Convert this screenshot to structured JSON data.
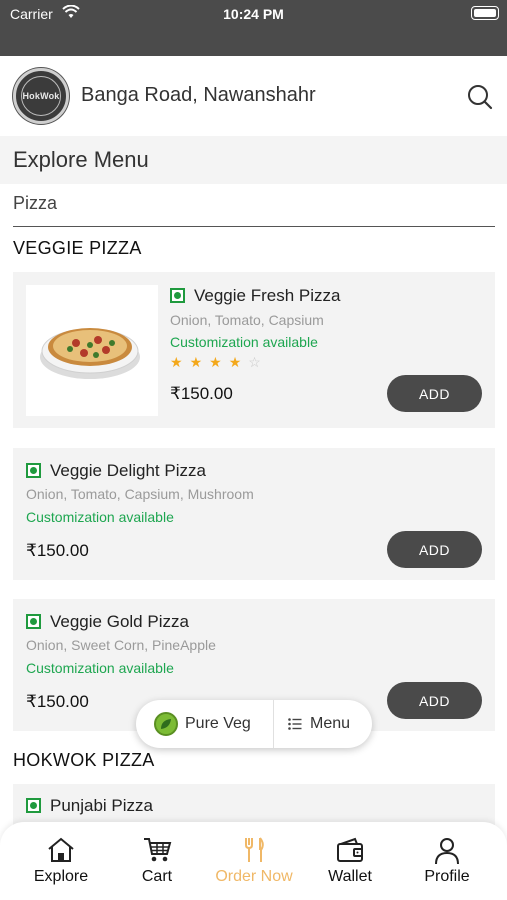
{
  "status_bar": {
    "carrier": "Carrier",
    "time": "10:24 PM"
  },
  "header": {
    "logo_text": "HokWok",
    "location": "Banga Road, Nawanshahr"
  },
  "explore": {
    "title": "Explore Menu",
    "category": "Pizza"
  },
  "sections": [
    {
      "title": "VEGGIE PIZZA"
    },
    {
      "title": "HOKWOK PIZZA"
    }
  ],
  "items": [
    {
      "name": "Veggie Fresh Pizza",
      "desc": "Onion, Tomato, Capsium",
      "custom": "Customization available",
      "price": "₹150.00",
      "add": "ADD",
      "rating": 4,
      "rating_max": 5
    },
    {
      "name": "Veggie Delight Pizza",
      "desc": "Onion, Tomato, Capsium, Mushroom",
      "custom": "Customization available",
      "price": "₹150.00",
      "add": "ADD"
    },
    {
      "name": "Veggie Gold Pizza",
      "desc": "Onion, Sweet Corn, PineApple",
      "custom": "Customization available",
      "price": "₹150.00",
      "add": "ADD"
    },
    {
      "name": "Punjabi Pizza"
    }
  ],
  "float_toggle": {
    "veg_label": "Pure Veg",
    "menu_label": "Menu"
  },
  "nav": [
    {
      "label": "Explore"
    },
    {
      "label": "Cart"
    },
    {
      "label": "Order Now",
      "active": true
    },
    {
      "label": "Wallet"
    },
    {
      "label": "Profile"
    }
  ],
  "colors": {
    "accent": "#f0b867",
    "veg_green": "#1f9a3e",
    "custom_green": "#1ea650",
    "star": "#f3a81b",
    "button": "#4a4a4a"
  }
}
